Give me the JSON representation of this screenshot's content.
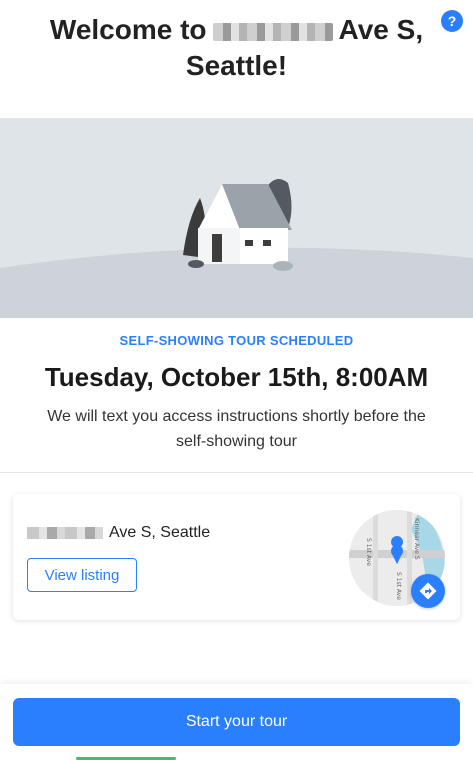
{
  "header": {
    "welcome_prefix": "Welcome to",
    "welcome_suffix": "Ave S,",
    "welcome_city": "Seattle!",
    "help_label": "?"
  },
  "tour": {
    "status": "SELF-SHOWING TOUR SCHEDULED",
    "datetime": "Tuesday, October 15th, 8:00AM",
    "instructions": "We will text you access instructions shortly before the self-showing tour"
  },
  "listing": {
    "address_suffix": "Ave S, Seattle",
    "view_listing_label": "View listing",
    "map_labels": [
      "S 1st Ave",
      "S 1st Ave",
      "Kinnear Ave S"
    ]
  },
  "footer": {
    "start_label": "Start your tour"
  },
  "colors": {
    "accent": "#2a7fff",
    "hero_bg": "#dfe4e8",
    "success": "#35c46e"
  },
  "icons": {
    "help": "question-circle-icon",
    "house": "house-illustration",
    "map_pin": "map-pin-icon",
    "directions": "directions-icon"
  }
}
